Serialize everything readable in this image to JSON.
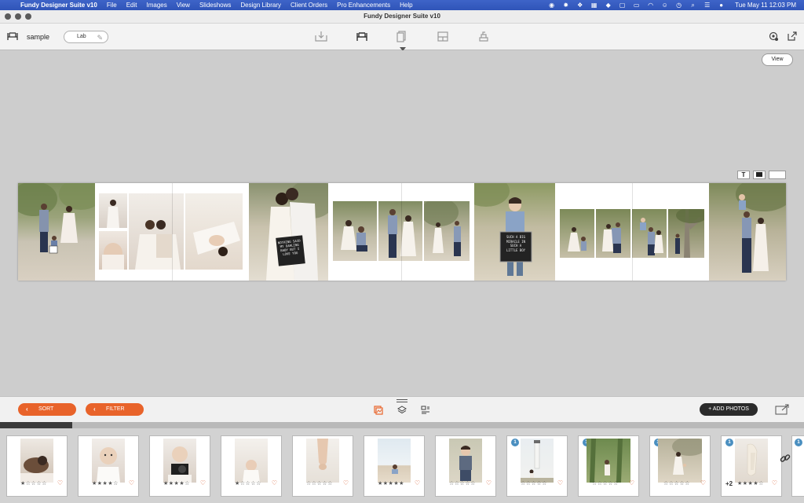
{
  "menubar": {
    "app_name": "Fundy Designer Suite v10",
    "items": [
      "File",
      "Edit",
      "Images",
      "View",
      "Slideshows",
      "Design Library",
      "Client Orders",
      "Pro Enhancements",
      "Help"
    ],
    "clock": "Tue May 11  12:03 PM"
  },
  "window": {
    "title": "Fundy Designer Suite v10"
  },
  "toolbar": {
    "project_name": "sample",
    "lab_label": "Lab"
  },
  "canvas": {
    "view_label": "View",
    "text_tool_label": "T"
  },
  "bottom": {
    "sort_label": "SORT",
    "filter_label": "FILTER",
    "add_photos_label": "+ ADD PHOTOS",
    "accent_color": "#e8632a"
  },
  "tray": {
    "scroll_progress_fraction": 0.09,
    "thumbs": [
      {
        "stars": "★☆☆☆☆",
        "badge": "",
        "extra": "",
        "heart": "♡"
      },
      {
        "stars": "★★★★☆",
        "badge": "",
        "extra": "",
        "heart": "♡"
      },
      {
        "stars": "★★★★☆",
        "badge": "",
        "extra": "",
        "heart": "♡"
      },
      {
        "stars": "★☆☆☆☆",
        "badge": "",
        "extra": "",
        "heart": "♡"
      },
      {
        "stars": "☆☆☆☆☆",
        "badge": "",
        "extra": "",
        "heart": "♡"
      },
      {
        "stars": "★★★★★",
        "badge": "",
        "extra": "",
        "heart": "♡"
      },
      {
        "stars": "☆☆☆☆☆",
        "badge": "",
        "extra": "",
        "heart": "♡"
      },
      {
        "stars": "☆☆☆☆☆",
        "badge": "1",
        "extra": "",
        "heart": "♡"
      },
      {
        "stars": "☆☆☆☆☆",
        "badge": "1",
        "extra": "",
        "heart": "♡"
      },
      {
        "stars": "☆☆☆☆☆",
        "badge": "1",
        "extra": "",
        "heart": "♡"
      },
      {
        "stars": "★★★★☆",
        "badge": "1",
        "extra": "+2",
        "heart": "♡"
      },
      {
        "stars": "",
        "badge": "1",
        "extra": "",
        "heart": ""
      }
    ]
  },
  "letterboards": [
    {
      "text": "NOTHING SAID MY DARLING BABY BUT I LOVE YOU"
    },
    {
      "text": "SUCH A BIG MIRACLE IN SUCH A LITTLE BOY"
    }
  ]
}
